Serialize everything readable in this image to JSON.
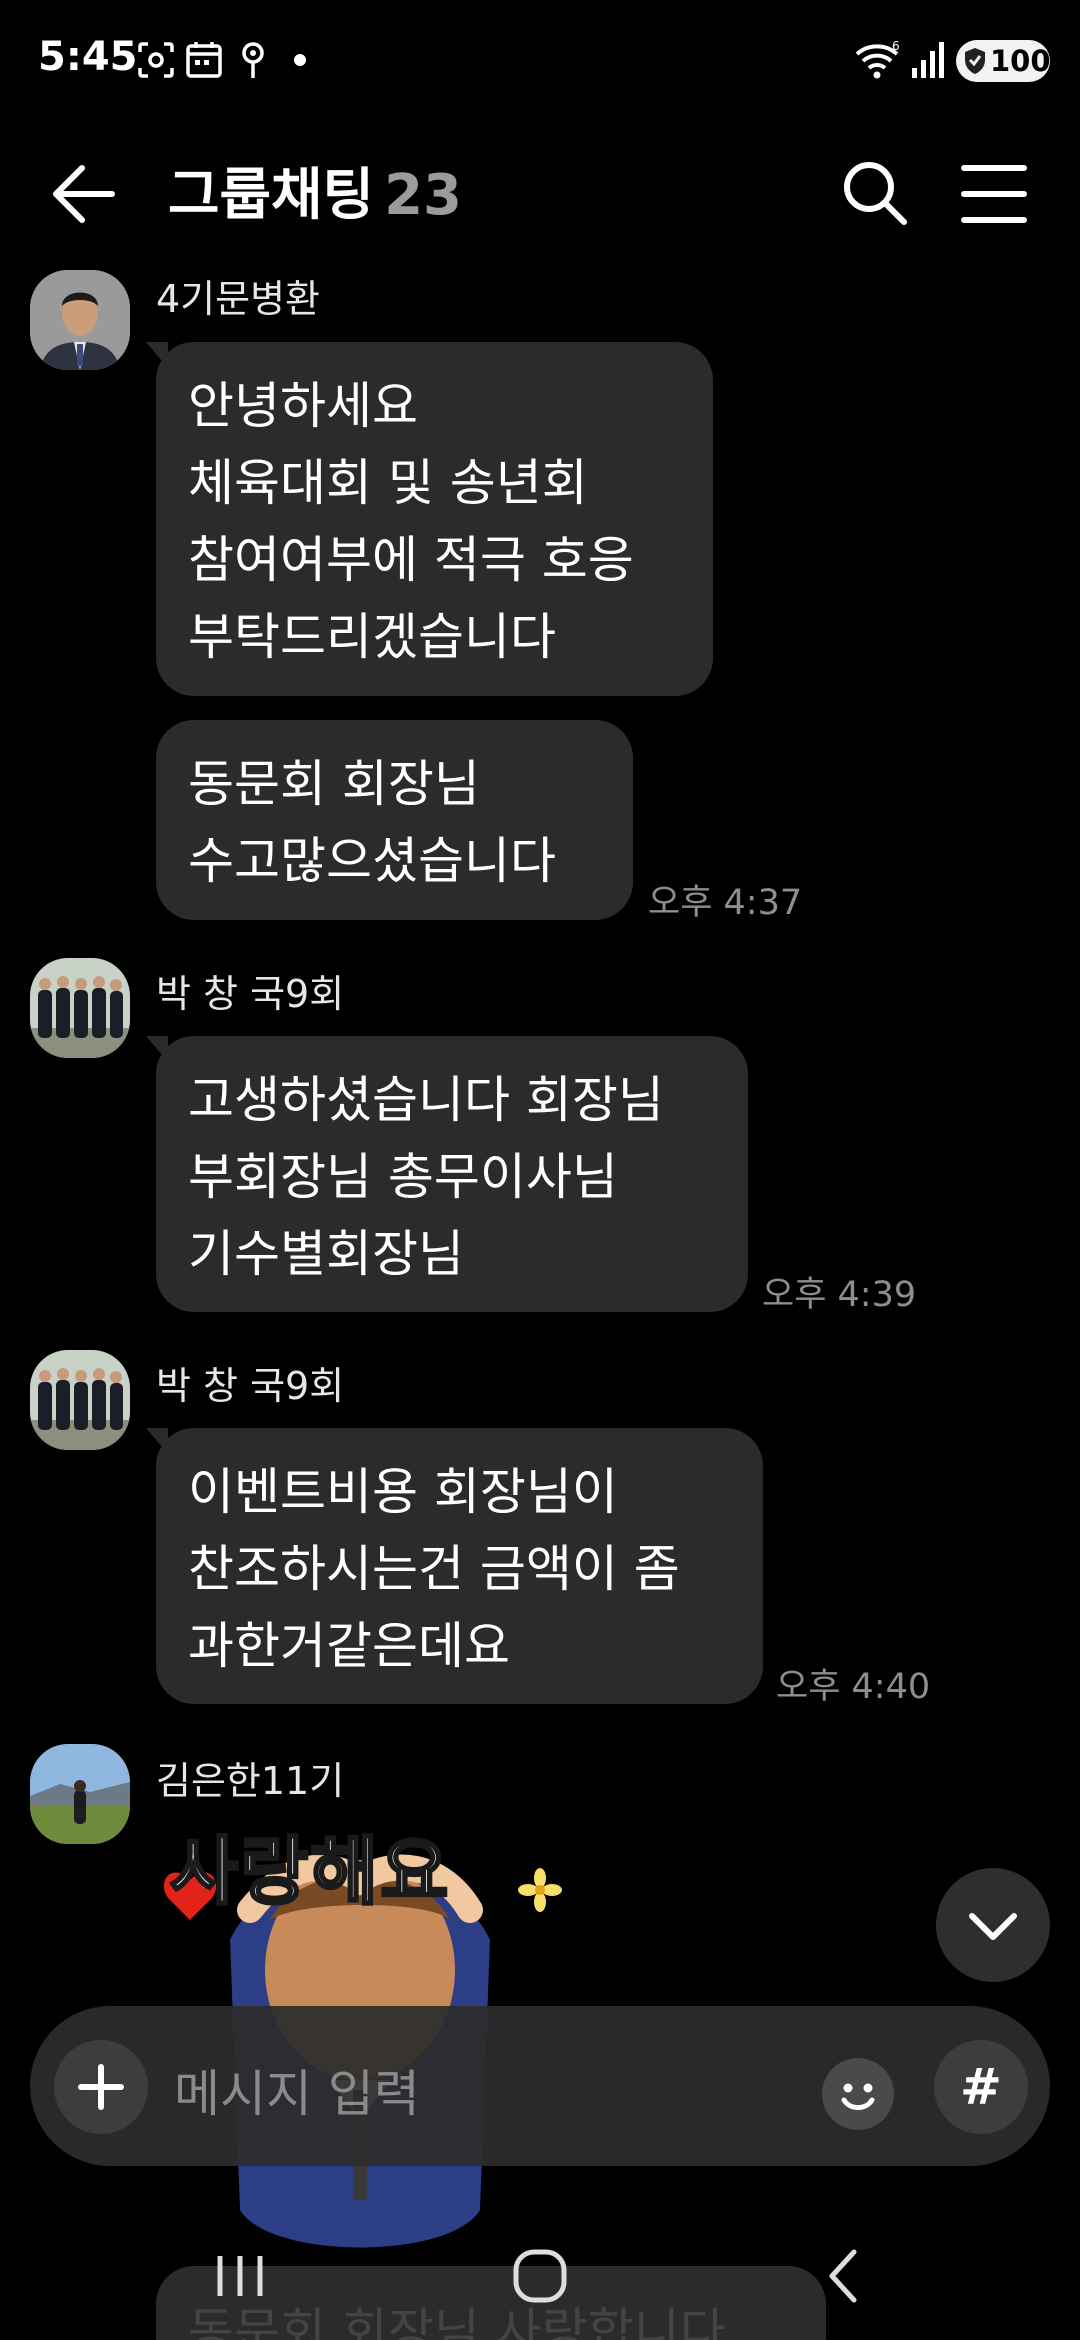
{
  "status_bar": {
    "time": "5:45",
    "battery": "100",
    "icons": [
      "screenshot-icon",
      "calendar-icon",
      "location-icon",
      "wifi-icon",
      "signal-icon",
      "battery-icon"
    ]
  },
  "header": {
    "title": "그룹채팅",
    "member_count": "23"
  },
  "messages": [
    {
      "sender": "4기문병환",
      "bubbles": [
        {
          "lines": [
            "안녕하세요",
            "체육대회 및 송년회",
            "참여여부에 적극 호응",
            "부탁드리겠습니다"
          ]
        },
        {
          "lines": [
            "동문회 회장님",
            "수고많으셨습니다"
          ],
          "time": "오후 4:37"
        }
      ]
    },
    {
      "sender": "박 창 국9회",
      "bubbles": [
        {
          "lines": [
            "고생하셨습니다 회장님",
            "부회장님 총무이사님",
            "기수별회장님"
          ],
          "time": "오후 4:39"
        }
      ]
    },
    {
      "sender": "박 창 국9회",
      "bubbles": [
        {
          "lines": [
            "이벤트비용 회장님이",
            "찬조하시는건 금액이 좀",
            "과한거같은데요"
          ],
          "time": "오후 4:40"
        }
      ]
    },
    {
      "sender": "김은한11기",
      "sticker_text": "사랑해요"
    }
  ],
  "peek_message": "동문회 회장님 사랑합니다",
  "input": {
    "placeholder": "메시지 입력",
    "hash_label": "#"
  },
  "colors": {
    "background": "#000000",
    "bubble": "#2b2b2b",
    "time_text": "#8e8e8e",
    "input_bar": "#2c2c2c"
  }
}
